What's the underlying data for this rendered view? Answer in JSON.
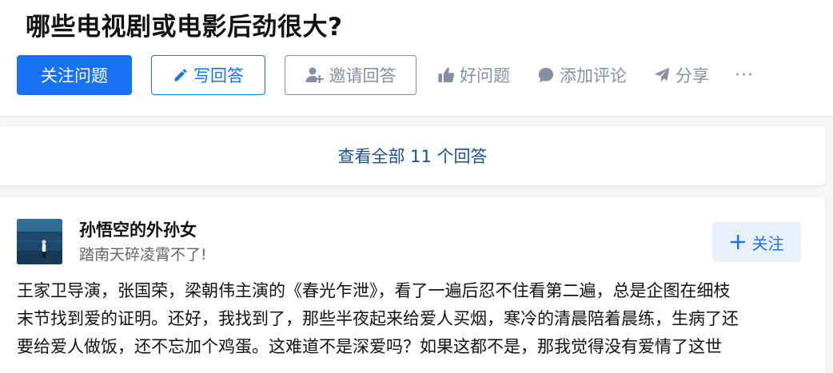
{
  "question": {
    "title": "哪些电视剧或电影后劲很大?"
  },
  "actions": {
    "follow_question": "关注问题",
    "write_answer": "写回答",
    "invite_answer": "邀请回答",
    "good_question": "好问题",
    "add_comment": "添加评论",
    "share": "分享",
    "more": "···"
  },
  "answers_summary": {
    "view_all": "查看全部 11 个回答"
  },
  "answer": {
    "author_name": "孙悟空的外孙女",
    "author_bio": "踏南天碎凌霄不了!",
    "follow_label": "关注",
    "content_lines": [
      "王家卫导演，张国荣，梁朝伟主演的《春光乍泄》，看了一遍后忍不住看第二遍，总是企图在细枝",
      "末节找到爱的证明。还好，我找到了，那些半夜起来给爱人买烟，寒冷的清晨陪着晨练，生病了还",
      "要给爱人做饭，还不忘加个鸡蛋。这难道不是深爱吗？如果这都不是，那我觉得没有爱情了这世"
    ]
  },
  "colors": {
    "brand": "#1772f6",
    "link": "#175199",
    "muted": "#8590a6",
    "page_bg": "#f6f6f6"
  }
}
